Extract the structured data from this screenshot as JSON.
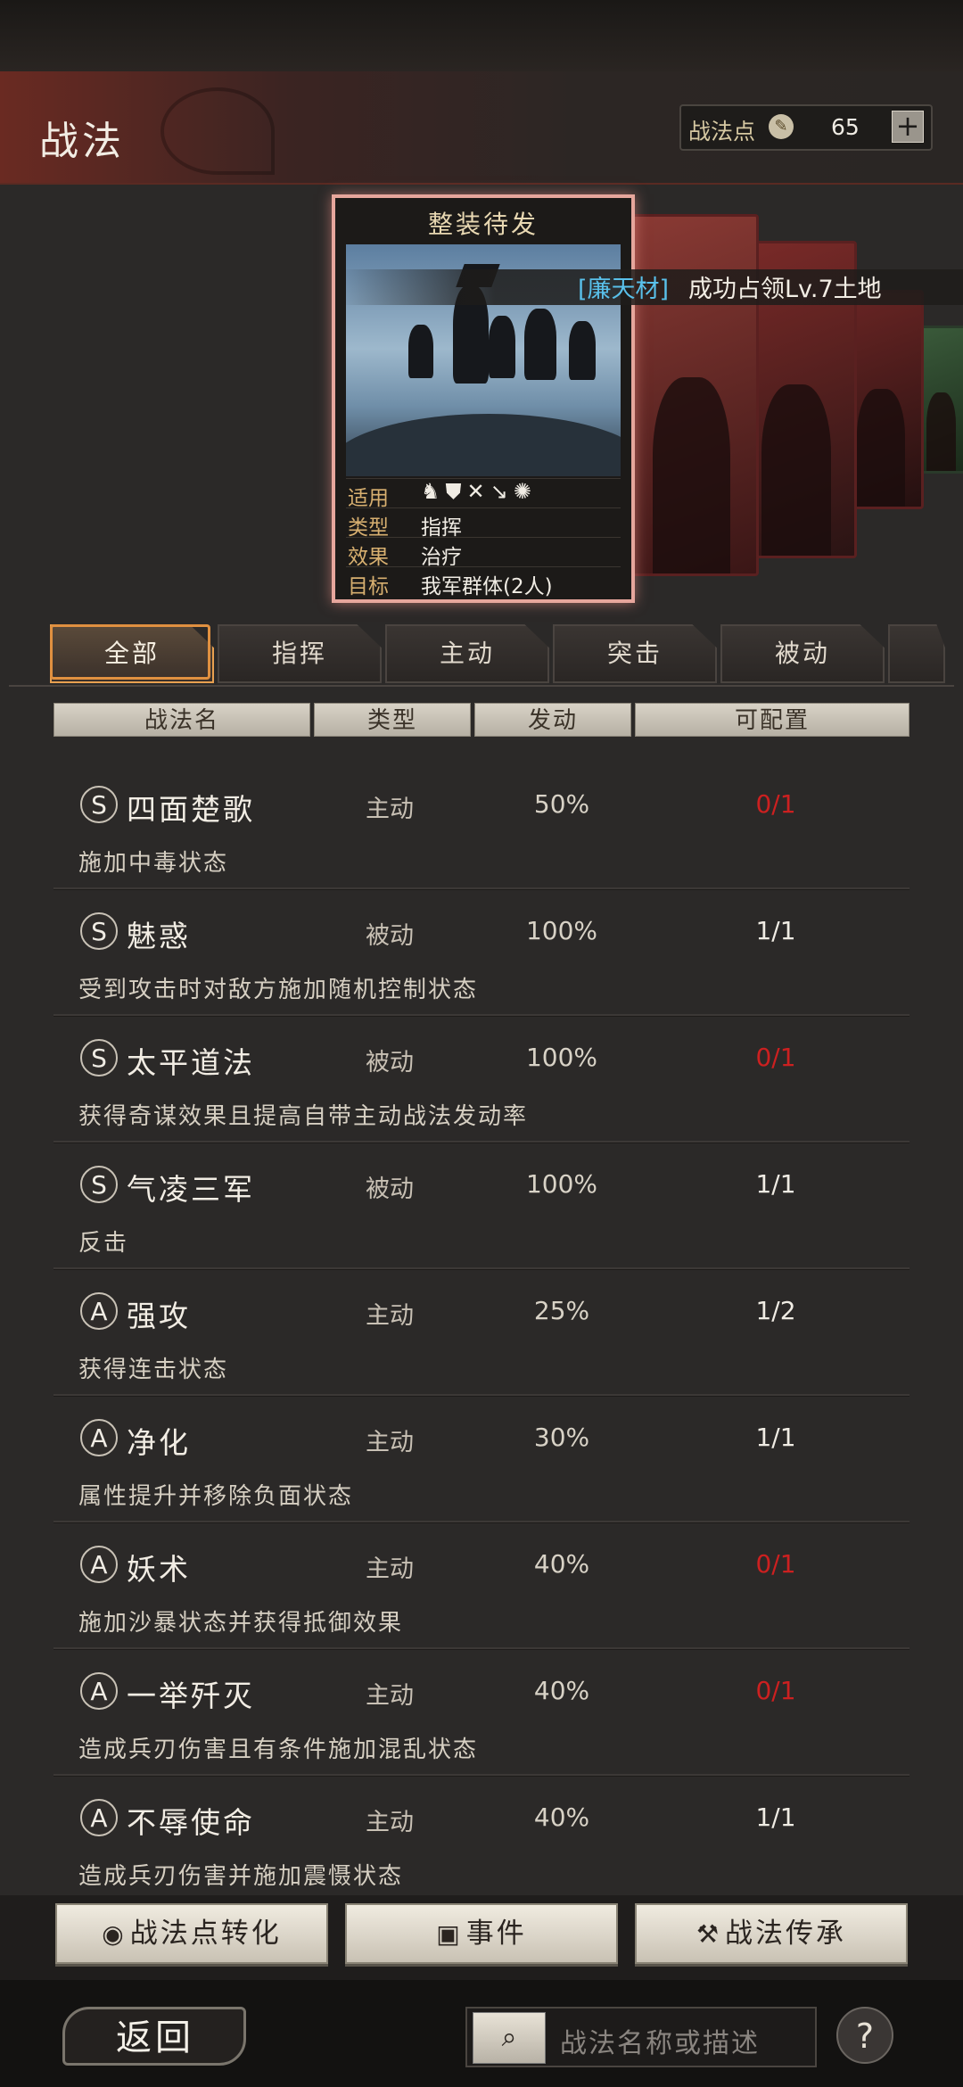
{
  "header": {
    "title": "战法",
    "points_label": "战法点",
    "points_value": "65",
    "plus_label": "+"
  },
  "ticker": {
    "name": "[廉天材]",
    "text": "成功占领Lv.7土地"
  },
  "card": {
    "title": "整装待发",
    "rows": [
      {
        "key": "适用",
        "value": ""
      },
      {
        "key": "类型",
        "value": "指挥"
      },
      {
        "key": "效果",
        "value": "治疗"
      },
      {
        "key": "目标",
        "value": "我军群体(2人)"
      }
    ],
    "unit_icons": [
      "cavalry-icon",
      "shield-icon",
      "bow-icon",
      "spear-icon",
      "chariot-icon"
    ]
  },
  "tabs": [
    {
      "label": "全部",
      "active": true
    },
    {
      "label": "指挥",
      "active": false
    },
    {
      "label": "主动",
      "active": false
    },
    {
      "label": "突击",
      "active": false
    },
    {
      "label": "被动",
      "active": false
    }
  ],
  "columns": [
    "战法名",
    "类型",
    "发动",
    "可配置"
  ],
  "tactics": [
    {
      "grade": "S",
      "name": "四面楚歌",
      "type": "主动",
      "rate": "50%",
      "config": "0/1",
      "config_red": true,
      "desc": "施加中毒状态"
    },
    {
      "grade": "S",
      "name": "魅惑",
      "type": "被动",
      "rate": "100%",
      "config": "1/1",
      "config_red": false,
      "desc": "受到攻击时对敌方施加随机控制状态"
    },
    {
      "grade": "S",
      "name": "太平道法",
      "type": "被动",
      "rate": "100%",
      "config": "0/1",
      "config_red": true,
      "desc": "获得奇谋效果且提高自带主动战法发动率"
    },
    {
      "grade": "S",
      "name": "气凌三军",
      "type": "被动",
      "rate": "100%",
      "config": "1/1",
      "config_red": false,
      "desc": "反击"
    },
    {
      "grade": "A",
      "name": "强攻",
      "type": "主动",
      "rate": "25%",
      "config": "1/2",
      "config_red": false,
      "desc": "获得连击状态"
    },
    {
      "grade": "A",
      "name": "净化",
      "type": "主动",
      "rate": "30%",
      "config": "1/1",
      "config_red": false,
      "desc": "属性提升并移除负面状态"
    },
    {
      "grade": "A",
      "name": "妖术",
      "type": "主动",
      "rate": "40%",
      "config": "0/1",
      "config_red": true,
      "desc": "施加沙暴状态并获得抵御效果"
    },
    {
      "grade": "A",
      "name": "一举歼灭",
      "type": "主动",
      "rate": "40%",
      "config": "0/1",
      "config_red": true,
      "desc": "造成兵刃伤害且有条件施加混乱状态"
    },
    {
      "grade": "A",
      "name": "不辱使命",
      "type": "主动",
      "rate": "40%",
      "config": "1/1",
      "config_red": false,
      "desc": "造成兵刃伤害并施加震慑状态"
    }
  ],
  "buttons": {
    "convert": "战法点转化",
    "events": "事件",
    "inherit": "战法传承"
  },
  "footer": {
    "back": "返回",
    "search_placeholder": "战法名称或描述",
    "help": "?"
  },
  "colors": {
    "accent_red": "#cc2020",
    "ticker_name": "#59c0ea",
    "tab_active_border": "#e09040"
  }
}
